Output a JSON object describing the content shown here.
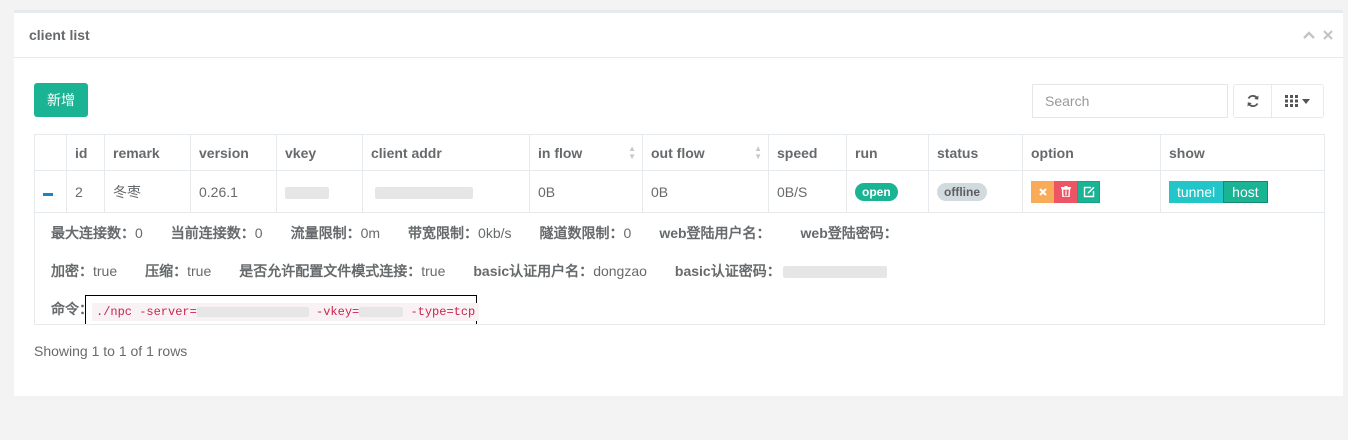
{
  "panel": {
    "title": "client list",
    "collapse_icon": "chevron-up-icon",
    "close_icon": "close-icon"
  },
  "toolbar": {
    "add_label": "新增",
    "search_placeholder": "Search"
  },
  "table": {
    "headers": [
      "id",
      "remark",
      "version",
      "vkey",
      "client addr",
      "in flow",
      "out flow",
      "speed",
      "run",
      "status",
      "option",
      "show"
    ],
    "rows": [
      {
        "id": "2",
        "remark": "冬枣",
        "version": "0.26.1",
        "in_flow": "0B",
        "out_flow": "0B",
        "speed": "0B/S",
        "run": "open",
        "status": "offline",
        "show_tunnel": "tunnel",
        "show_host": "host"
      }
    ]
  },
  "detail": {
    "line1": [
      {
        "label": "最大连接数：",
        "value": "0"
      },
      {
        "label": "当前连接数：",
        "value": "0"
      },
      {
        "label": "流量限制：",
        "value": "0m"
      },
      {
        "label": "带宽限制：",
        "value": "0kb/s"
      },
      {
        "label": "隧道数限制：",
        "value": "0"
      },
      {
        "label": "web登陆用户名：",
        "value": ""
      },
      {
        "label": "web登陆密码：",
        "value": ""
      }
    ],
    "line2": [
      {
        "label": "加密：",
        "value": "true"
      },
      {
        "label": "压缩：",
        "value": "true"
      },
      {
        "label": "是否允许配置文件模式连接：",
        "value": "true"
      },
      {
        "label": "basic认证用户名：",
        "value": "dongzao"
      },
      {
        "label": "basic认证密码：",
        "value": ""
      }
    ],
    "command_label": "命令：",
    "command_part1": "./npc -server=",
    "command_part2": " -vkey=",
    "command_part3": " -type=tcp"
  },
  "footer": {
    "rows_info": "Showing 1 to 1 of 1 rows"
  },
  "colors": {
    "primary": "#1ab394",
    "info": "#23c6c8",
    "warning": "#f8ac59",
    "danger": "#ed5565"
  }
}
